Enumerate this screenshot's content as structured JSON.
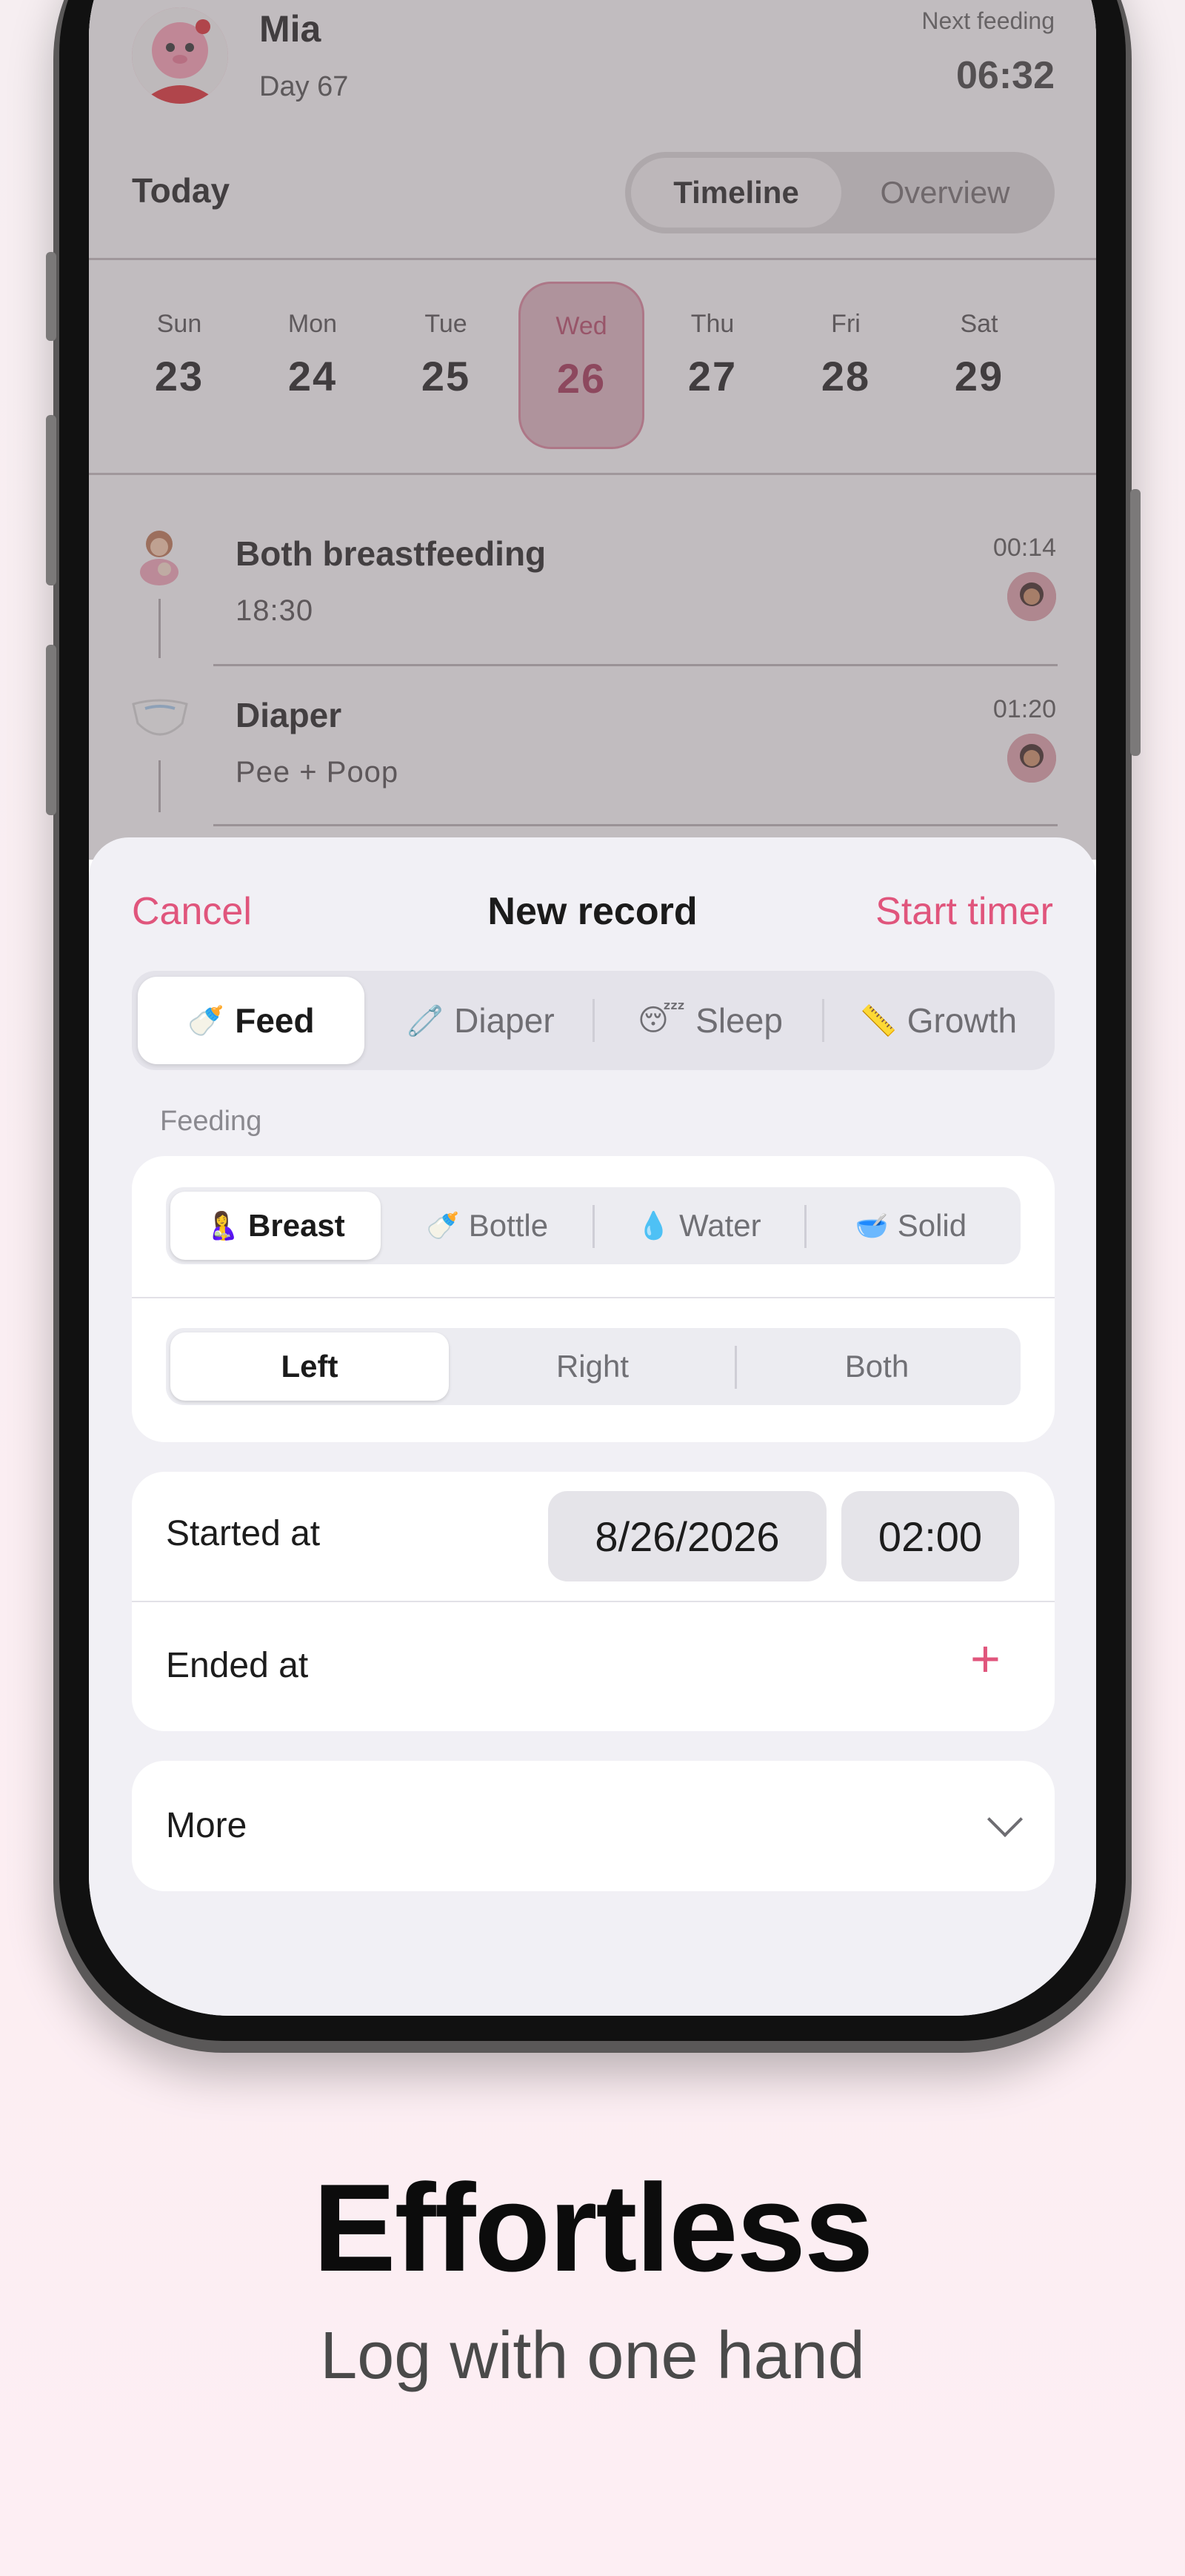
{
  "header": {
    "baby_name": "Mia",
    "baby_day": "Day 67",
    "next_feeding_label": "Next feeding",
    "next_feeding_time": "06:32"
  },
  "toolbar": {
    "today_label": "Today",
    "view_options": [
      "Timeline",
      "Overview"
    ],
    "selected_view": "Timeline"
  },
  "week": [
    {
      "day": "Sun",
      "date": "23"
    },
    {
      "day": "Mon",
      "date": "24"
    },
    {
      "day": "Tue",
      "date": "25"
    },
    {
      "day": "Wed",
      "date": "26"
    },
    {
      "day": "Thu",
      "date": "27"
    },
    {
      "day": "Fri",
      "date": "28"
    },
    {
      "day": "Sat",
      "date": "29"
    }
  ],
  "selected_day_index": 3,
  "timeline": [
    {
      "icon": "breastfeeding-icon",
      "title": "Both breastfeeding",
      "subtitle": "18:30",
      "duration": "00:14"
    },
    {
      "icon": "diaper-icon",
      "title": "Diaper",
      "subtitle": "Pee + Poop",
      "duration": "01:20"
    }
  ],
  "sheet": {
    "cancel_label": "Cancel",
    "title": "New record",
    "start_timer_label": "Start timer",
    "categories": [
      {
        "icon": "🍼",
        "label": "Feed"
      },
      {
        "icon": "🧷",
        "label": "Diaper"
      },
      {
        "icon": "😴",
        "label": "Sleep"
      },
      {
        "icon": "📏",
        "label": "Growth"
      }
    ],
    "selected_category": "Feed",
    "section_label": "Feeding",
    "feed_types": [
      {
        "icon": "🤱",
        "label": "Breast"
      },
      {
        "icon": "🍼",
        "label": "Bottle"
      },
      {
        "icon": "💧",
        "label": "Water"
      },
      {
        "icon": "🥣",
        "label": "Solid"
      }
    ],
    "selected_feed_type": "Breast",
    "sides": [
      "Left",
      "Right",
      "Both"
    ],
    "selected_side": "Left",
    "started_at_label": "Started at",
    "started_date": "8/26/2026",
    "started_time": "02:00",
    "ended_at_label": "Ended at",
    "more_label": "More"
  },
  "marketing": {
    "headline": "Effortless",
    "subline": "Log with one hand"
  },
  "colors": {
    "accent": "#e0557c",
    "selected_day_bg": "#d8aebb",
    "background": "#fbeef2"
  }
}
